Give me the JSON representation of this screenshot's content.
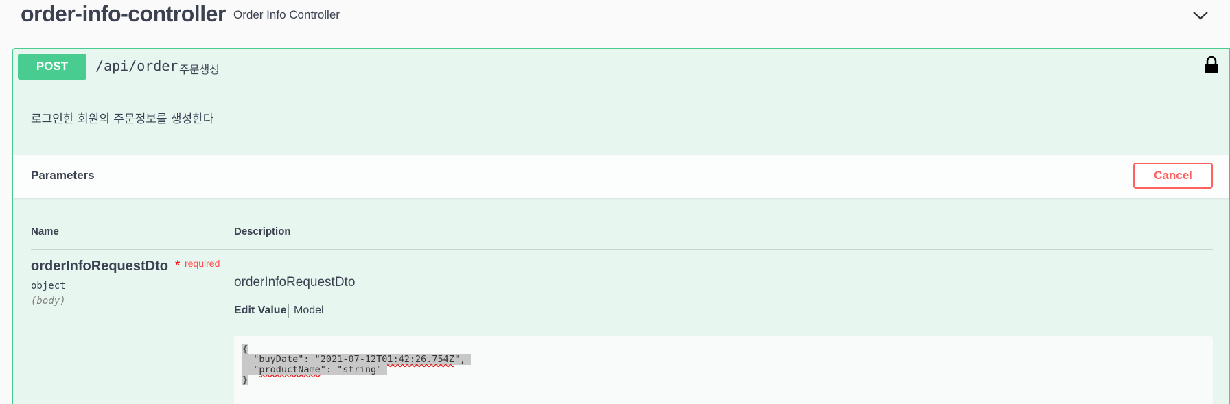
{
  "tag": {
    "name": "order-info-controller",
    "description": "Order Info Controller"
  },
  "operation": {
    "method": "POST",
    "path": "/api/order",
    "summary": "주문생성",
    "description": "로그인한 회원의 주문정보를 생성한다"
  },
  "parameters_section": {
    "title": "Parameters",
    "cancel_label": "Cancel",
    "columns": {
      "name": "Name",
      "description": "Description"
    },
    "param": {
      "name": "orderInfoRequestDto",
      "asterisk": "*",
      "required_label": "required",
      "type": "object",
      "in": "(body)",
      "desc_title": "orderInfoRequestDto",
      "tab_edit": "Edit Value",
      "tab_model": "Model"
    }
  },
  "body_editor": {
    "line1": "{",
    "line2_prefix": "  \"",
    "line2_key": "buyDate",
    "line2_mid": "\": \"2021-07-",
    "line2_sq": "12T01:42:26.754Z",
    "line2_end": "\",",
    "line3_prefix": "  \"",
    "line3_key": "productName",
    "line3_end": "\": \"string\"",
    "line4": "}"
  },
  "colors": {
    "post_green": "#49cc90",
    "opblock_bg": "#e8f6f0",
    "cancel_red": "#ff6060"
  },
  "icons": [
    "chevron-down-icon",
    "lock-icon"
  ]
}
